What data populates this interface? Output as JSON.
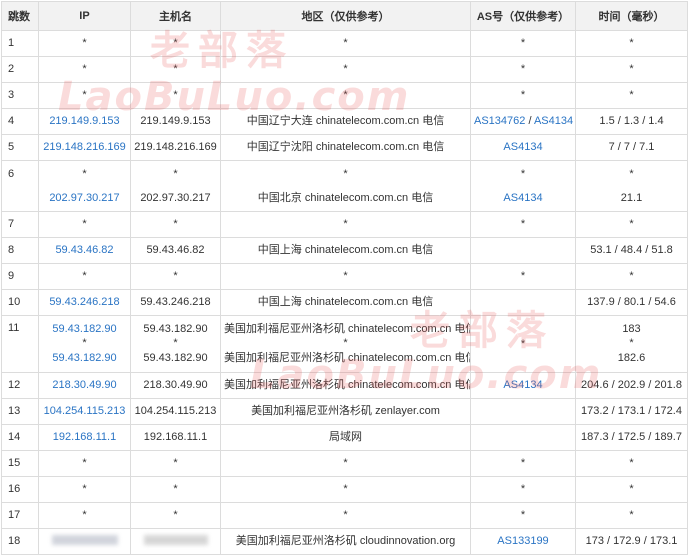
{
  "headers": {
    "hop": "跳数",
    "ip": "IP",
    "host": "主机名",
    "region": "地区（仅供参考）",
    "asn": "AS号（仅供参考）",
    "time": "时间（毫秒）"
  },
  "watermark": {
    "cn": "老部落",
    "en": "LaoBuLuo.com"
  },
  "rows": [
    {
      "hop": "1",
      "ip": "*",
      "host": "*",
      "region": "*",
      "asn": "*",
      "time": "*"
    },
    {
      "hop": "2",
      "ip": "*",
      "host": "*",
      "region": "*",
      "asn": "*",
      "time": "*"
    },
    {
      "hop": "3",
      "ip": "*",
      "host": "*",
      "region": "*",
      "asn": "*",
      "time": "*"
    },
    {
      "hop": "4",
      "ip": "219.149.9.153",
      "host": "219.149.9.153",
      "region": "中国辽宁大连 chinatelecom.com.cn 电信",
      "asn": "AS134762",
      "asn_sep": " / ",
      "asn2": "AS4134",
      "time": "1.5 / 1.3 / 1.4"
    },
    {
      "hop": "5",
      "ip": "219.148.216.169",
      "host": "219.148.216.169",
      "region": "中国辽宁沈阳 chinatelecom.com.cn 电信",
      "asn": "AS4134",
      "time": "7 / 7 / 7.1"
    },
    {
      "hop": "6",
      "l1": {
        "ip": "*",
        "host": "*",
        "region": "*",
        "asn": "*",
        "time": "*"
      },
      "l2": {
        "ip": "202.97.30.217",
        "host": "202.97.30.217",
        "region": "中国北京 chinatelecom.com.cn 电信",
        "asn": "AS4134",
        "time": "21.1"
      }
    },
    {
      "hop": "7",
      "ip": "*",
      "host": "*",
      "region": "*",
      "asn": "*",
      "time": "*"
    },
    {
      "hop": "8",
      "ip": "59.43.46.82",
      "host": "59.43.46.82",
      "region": "中国上海 chinatelecom.com.cn 电信",
      "asn": "",
      "time": "53.1 / 48.4 / 51.8"
    },
    {
      "hop": "9",
      "ip": "*",
      "host": "*",
      "region": "*",
      "asn": "*",
      "time": "*"
    },
    {
      "hop": "10",
      "ip": "59.43.246.218",
      "host": "59.43.246.218",
      "region": "中国上海 chinatelecom.com.cn 电信",
      "asn": "",
      "time": "137.9 / 80.1 / 54.6"
    },
    {
      "hop": "11",
      "l1": {
        "ip": "59.43.182.90",
        "host": "59.43.182.90",
        "region": "美国加利福尼亚州洛杉矶 chinatelecom.com.cn 电信",
        "time": "183"
      },
      "mid": {
        "ip": "*",
        "host": "*",
        "region": "*",
        "asn": "*",
        "time": "*"
      },
      "l2": {
        "ip": "59.43.182.90",
        "host": "59.43.182.90",
        "region": "美国加利福尼亚州洛杉矶 chinatelecom.com.cn 电信",
        "time": "182.6"
      }
    },
    {
      "hop": "12",
      "ip": "218.30.49.90",
      "host": "218.30.49.90",
      "region": "美国加利福尼亚州洛杉矶 chinatelecom.com.cn 电信",
      "asn": "AS4134",
      "time": "204.6 / 202.9 / 201.8"
    },
    {
      "hop": "13",
      "ip": "104.254.115.213",
      "host": "104.254.115.213",
      "region": "美国加利福尼亚州洛杉矶 zenlayer.com",
      "asn": "",
      "time": "173.2 / 173.1 / 172.4"
    },
    {
      "hop": "14",
      "ip": "192.168.11.1",
      "host": "192.168.11.1",
      "region": "局域网",
      "asn": "",
      "time": "187.3 / 172.5 / 189.7"
    },
    {
      "hop": "15",
      "ip": "*",
      "host": "*",
      "region": "*",
      "asn": "*",
      "time": "*"
    },
    {
      "hop": "16",
      "ip": "*",
      "host": "*",
      "region": "*",
      "asn": "*",
      "time": "*"
    },
    {
      "hop": "17",
      "ip": "*",
      "host": "*",
      "region": "*",
      "asn": "*",
      "time": "*"
    },
    {
      "hop": "18",
      "ip_redacted": true,
      "host_redacted": true,
      "region": "美国加利福尼亚州洛杉矶 cloudinnovation.org",
      "asn": "AS133199",
      "time": "173 / 172.9 / 173.1"
    }
  ],
  "colors": {
    "link": "#2a74c4",
    "header_bg": "#f2f2f2",
    "border": "#dcdcdc",
    "watermark": "#e85a5a"
  }
}
